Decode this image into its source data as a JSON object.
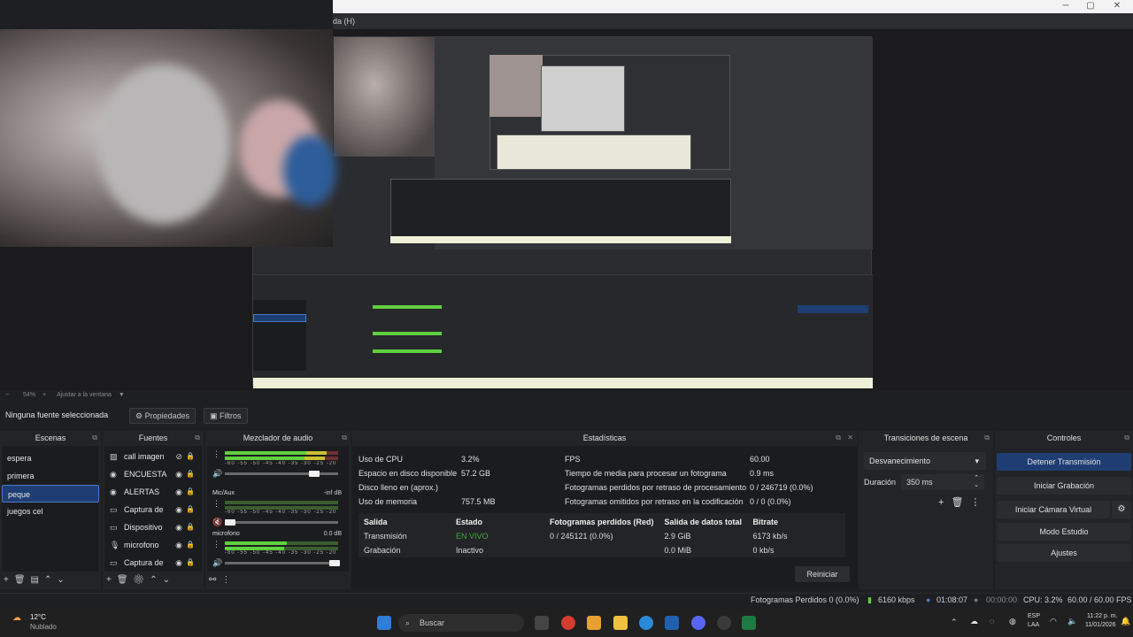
{
  "window": {
    "title_fragment": "da (H)"
  },
  "preview": {
    "zoom": "54%",
    "fit": "Ajustar a la ventana"
  },
  "source_toolbar": {
    "label": "Ninguna fuente seleccionada",
    "properties": "Propiedades",
    "filters": "Filtros"
  },
  "docks": {
    "scenes": {
      "title": "Escenas",
      "items": [
        "espera",
        "primera",
        "peque",
        "juegos cel"
      ],
      "selected": "peque"
    },
    "sources": {
      "title": "Fuentes",
      "items": [
        {
          "label": "call imagen",
          "icon": "image-icon"
        },
        {
          "label": "ENCUESTA",
          "icon": "browser-icon"
        },
        {
          "label": "ALERTAS",
          "icon": "browser-icon"
        },
        {
          "label": "Captura de",
          "icon": "window-capture-icon"
        },
        {
          "label": "Dispositivo",
          "icon": "camera-icon"
        },
        {
          "label": "microfono",
          "icon": "microphone-icon"
        },
        {
          "label": "Captura de",
          "icon": "window-capture-icon"
        }
      ]
    },
    "mixer": {
      "title": "Mezclador de audio",
      "scale": "-60 -55 -50 -45 -40 -35 -30 -25 -20 -15 -10 -5 0",
      "channels": [
        {
          "name": "",
          "db": "",
          "level": 0.8
        },
        {
          "name": "Mic/Aux",
          "db": "-inf dB",
          "level": 0.0
        },
        {
          "name": "microfono",
          "db": "0.0 dB",
          "level": 0.6
        }
      ]
    },
    "stats": {
      "title": "Estadísticas",
      "left": [
        {
          "label": "Uso de CPU",
          "value": "3.2%"
        },
        {
          "label": "Espacio en disco disponible",
          "value": "57.2 GB"
        },
        {
          "label": "Disco lleno en (aprox.)",
          "value": ""
        },
        {
          "label": "Uso de memoria",
          "value": "757.5 MB"
        }
      ],
      "right": [
        {
          "label": "FPS",
          "value": "60.00"
        },
        {
          "label": "Tiempo de media para procesar un fotograma",
          "value": "0.9 ms"
        },
        {
          "label": "Fotogramas perdidos por retraso de procesamiento",
          "value": "0 / 246719 (0.0%)"
        },
        {
          "label": "Fotogramas omitidos por retraso en la codificación",
          "value": "0 / 0 (0.0%)"
        }
      ],
      "table_headers": [
        "Salida",
        "Estado",
        "Fotogramas perdidos (Red)",
        "Salida de datos total",
        "Bitrate"
      ],
      "table_rows": [
        [
          "Transmisión",
          "EN VIVO",
          "0 / 245121 (0.0%)",
          "2.9 GiB",
          "6173 kb/s"
        ],
        [
          "Grabación",
          "Inactivo",
          "",
          "0.0 MiB",
          "0 kb/s"
        ]
      ],
      "reset": "Reiniciar"
    },
    "transitions": {
      "title": "Transiciones de escena",
      "selected": "Desvanecimiento",
      "duration_label": "Duración",
      "duration": "350 ms"
    },
    "controls": {
      "title": "Controles",
      "buttons": [
        "Detener Transmisión",
        "Iniciar Grabación",
        "Iniciar Cámara Virtual",
        "Modo Estudio",
        "Ajustes"
      ]
    }
  },
  "status": {
    "dropped": "Fotogramas Perdidos 0 (0.0%)",
    "kbps": "6160 kbps",
    "stream_time": "01:08:07",
    "rec_time": "00:00:00",
    "cpu": "CPU: 3.2%",
    "fps": "60.00 / 60.00 FPS"
  },
  "taskbar": {
    "weather_temp": "12°C",
    "weather_desc": "Nublado",
    "search": "Buscar",
    "lang1": "ESP",
    "lang2": "LAA",
    "time": "11:22 p. m.",
    "date": "11/01/2026"
  },
  "colors": {
    "accent": "#1e3e73",
    "live": "#3fa83f",
    "meter_green": "#5fd03f"
  }
}
